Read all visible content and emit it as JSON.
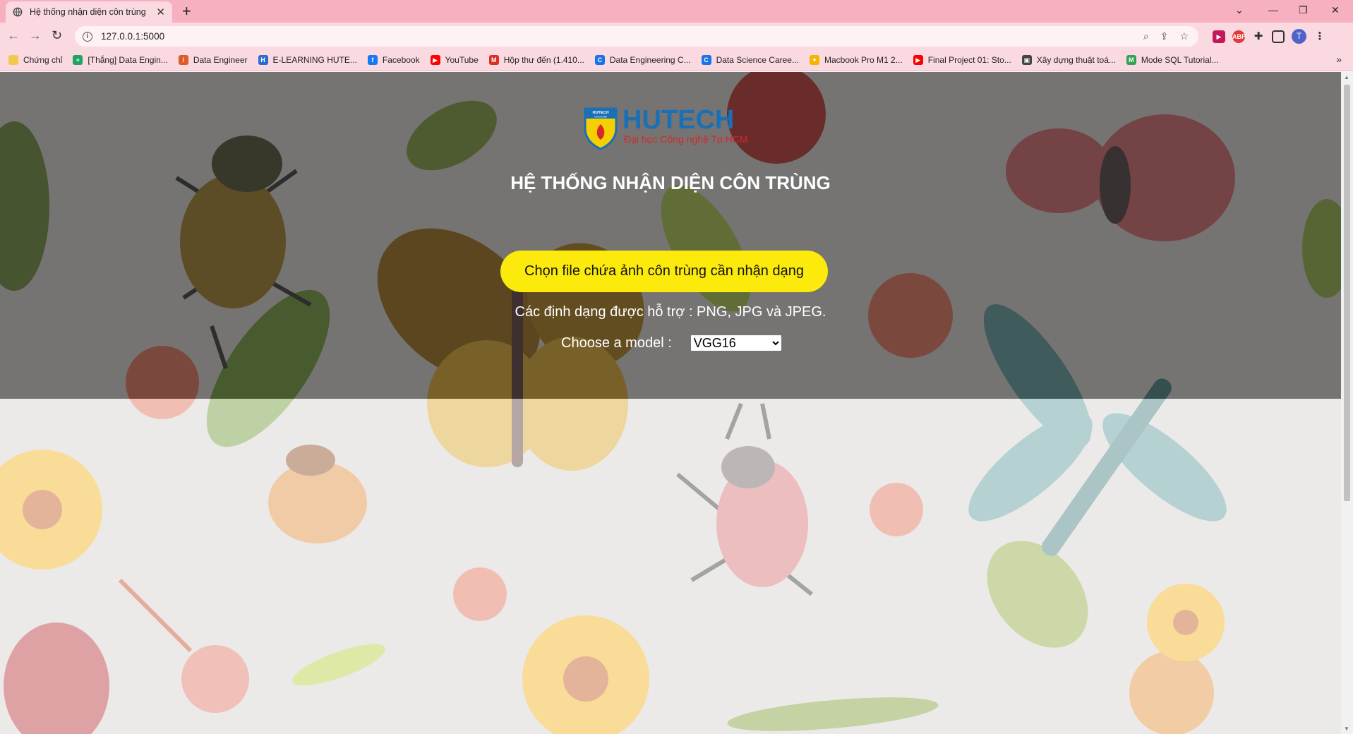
{
  "browser": {
    "tab_title": "Hệ thống nhận diện côn trùng",
    "url": "127.0.0.1:5000",
    "profile_initial": "T",
    "bookmarks": [
      {
        "label": "Chứng chỉ",
        "icon": "folder-icon",
        "color": "#f2c94c"
      },
      {
        "label": "[Thắng] Data Engin...",
        "icon": "sheets-icon",
        "color": "#1fa463"
      },
      {
        "label": "Data Engineer",
        "icon": "brush-icon",
        "color": "#e05a2b"
      },
      {
        "label": "E-LEARNING HUTE...",
        "icon": "hutech-icon",
        "color": "#2a6bd1"
      },
      {
        "label": "Facebook",
        "icon": "facebook-icon",
        "color": "#1877f2"
      },
      {
        "label": "YouTube",
        "icon": "youtube-icon",
        "color": "#ff0000"
      },
      {
        "label": "Hộp thư đến (1.410...",
        "icon": "gmail-icon",
        "color": "#d93025"
      },
      {
        "label": "Data Engineering C...",
        "icon": "c-icon",
        "color": "#1a73e8"
      },
      {
        "label": "Data Science Caree...",
        "icon": "c-icon",
        "color": "#1a73e8"
      },
      {
        "label": "Macbook Pro M1 2...",
        "icon": "pin-icon",
        "color": "#f4b400"
      },
      {
        "label": "Final Project 01: Sto...",
        "icon": "youtube-icon",
        "color": "#ff0000"
      },
      {
        "label": "Xây dựng thuật toá...",
        "icon": "image-icon",
        "color": "#444444"
      },
      {
        "label": "Mode SQL Tutorial...",
        "icon": "mode-icon",
        "color": "#31a354"
      }
    ]
  },
  "page": {
    "logo_text": "HUTECH",
    "logo_subtitle": "Đại học Công nghệ Tp.HCM",
    "logo_badge_text": "HUTECH",
    "logo_badge_sub": "University",
    "title": "HỆ THỐNG NHẬN DIỆN CÔN TRÙNG",
    "upload_label": "Chọn file chứa ảnh côn trùng cần nhận dạng",
    "formats_text": "Các định dạng được hỗ trợ : PNG, JPG và JPEG.",
    "model_label": "Choose a model :",
    "model_selected": "VGG16"
  },
  "colors": {
    "chrome": "#f6b0bf",
    "upload_button": "#fcea0c",
    "logo_blue": "#1a6fb5",
    "logo_red": "#d7262c"
  }
}
